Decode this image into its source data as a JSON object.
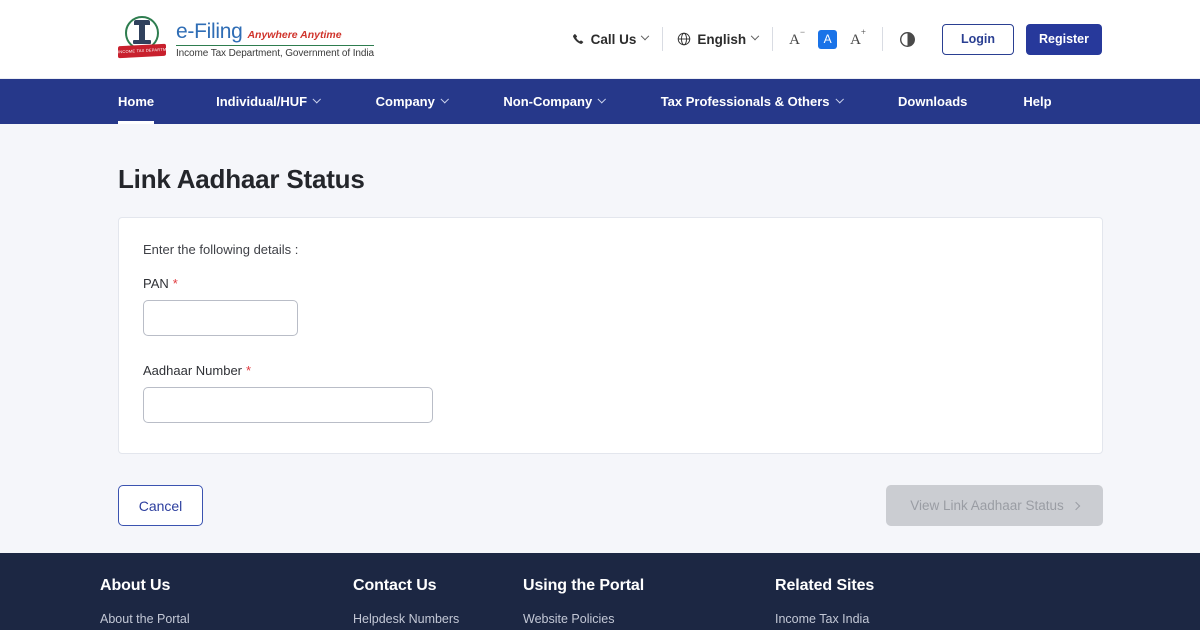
{
  "header": {
    "logo": {
      "emblem_caption": "INCOME TAX DEPARTMENT",
      "title": "e-Filing",
      "tagline": "Anywhere Anytime",
      "department": "Income Tax Department, Government of India"
    },
    "call_us": "Call Us",
    "language": "English",
    "font_decrease": "A",
    "font_normal": "A",
    "font_increase": "A",
    "login": "Login",
    "register": "Register"
  },
  "nav": {
    "items": [
      {
        "label": "Home",
        "has_chevron": false,
        "active": true
      },
      {
        "label": "Individual/HUF",
        "has_chevron": true,
        "active": false
      },
      {
        "label": "Company",
        "has_chevron": true,
        "active": false
      },
      {
        "label": "Non-Company",
        "has_chevron": true,
        "active": false
      },
      {
        "label": "Tax Professionals & Others",
        "has_chevron": true,
        "active": false
      },
      {
        "label": "Downloads",
        "has_chevron": false,
        "active": false
      },
      {
        "label": "Help",
        "has_chevron": false,
        "active": false
      }
    ]
  },
  "main": {
    "page_title": "Link Aadhaar Status",
    "form": {
      "hint": "Enter the following details :",
      "pan": {
        "label": "PAN",
        "required_mark": "*",
        "value": "",
        "placeholder": ""
      },
      "aadhaar": {
        "label": "Aadhaar Number",
        "required_mark": "*",
        "value": "",
        "placeholder": ""
      }
    },
    "actions": {
      "cancel": "Cancel",
      "submit": "View Link Aadhaar Status",
      "submit_disabled": true
    }
  },
  "footer": {
    "columns": [
      {
        "title": "About Us",
        "links": [
          "About the Portal"
        ]
      },
      {
        "title": "Contact Us",
        "links": [
          "Helpdesk Numbers"
        ]
      },
      {
        "title": "Using the Portal",
        "links": [
          "Website Policies"
        ]
      },
      {
        "title": "Related Sites",
        "links": [
          "Income Tax India"
        ]
      }
    ]
  },
  "colors": {
    "nav_blue": "#26388a",
    "register_blue": "#27399b",
    "footer_navy": "#1c2743",
    "page_bg": "#f5f6fa",
    "required_red": "#e0393e",
    "accent_blue": "#1a73e8",
    "emblem_green": "#2e7d4f",
    "emblem_red": "#c8202d"
  }
}
